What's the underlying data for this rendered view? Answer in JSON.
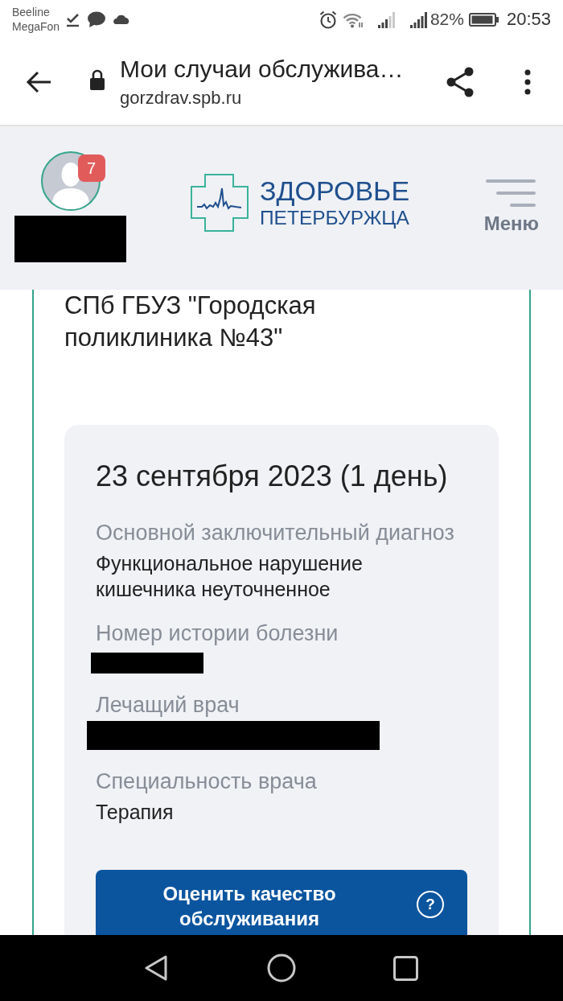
{
  "status_bar": {
    "carriers": [
      "Beeline",
      "MegaFon"
    ],
    "battery": "82%",
    "time": "20:53"
  },
  "browser_toolbar": {
    "title": "Мои случаи обслужива…",
    "url": "gorzdrav.spb.ru"
  },
  "site_header": {
    "account": {
      "badge": "7",
      "name_redacted": true
    },
    "logo": {
      "line_1": "ЗДОРОВЬЕ",
      "line_2": "ПЕТЕРБУРЖЦА"
    },
    "menu": {
      "label": "Меню"
    }
  },
  "case": {
    "clinic": "СПб ГБУЗ \"Городская поликлиника №43\"",
    "visit": {
      "date": "23 сентября 2023 (1 день)",
      "fields": [
        {
          "label": "Основной заключительный диагноз",
          "value": "Функциональное нарушение кишечника неуточненное",
          "redacted": false
        },
        {
          "label": "Номер истории болезни",
          "redacted": true
        },
        {
          "label": "Лечащий врач",
          "redacted": true
        },
        {
          "label": "Специальность врача",
          "value": "Терапия",
          "redacted": false
        }
      ],
      "rate_button": {
        "label": "Оценить качество обслуживания",
        "help_icon": "?"
      }
    }
  }
}
